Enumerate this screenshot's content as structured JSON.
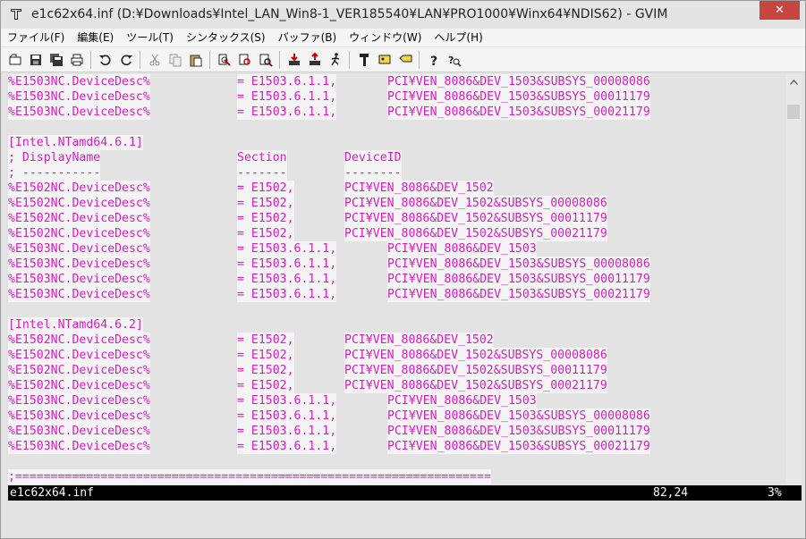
{
  "window": {
    "title": "e1c62x64.inf (D:¥Downloads¥Intel_LAN_Win8-1_VER185540¥LAN¥PRO1000¥Winx64¥NDIS62) - GVIM",
    "close_label": "✕"
  },
  "menu": [
    "ファイル(F)",
    "編集(E)",
    "ツール(T)",
    "シンタックス(S)",
    "バッファ(B)",
    "ウィンドウ(W)",
    "ヘルプ(H)"
  ],
  "toolbar": {
    "icons": [
      "open-icon",
      "save-icon",
      "save-all-icon",
      "print-icon",
      "sep",
      "undo-icon",
      "redo-icon",
      "sep",
      "cut-icon",
      "copy-icon",
      "paste-icon",
      "sep",
      "replace-icon",
      "find-next-icon",
      "find-prev-icon",
      "sep",
      "load-session-icon",
      "save-session-icon",
      "run-script-icon",
      "sep",
      "make-icon",
      "tags-icon",
      "jump-tag-icon",
      "sep",
      "help-icon",
      "find-help-icon"
    ]
  },
  "editor": {
    "lines": [
      {
        "t": "e",
        "c0": "%E1503NC.DeviceDesc%",
        "c1": "= E1503.6.1.1,",
        "c2": "PCI¥VEN_8086&DEV_1503&SUBSYS_00008086",
        "c2b": true
      },
      {
        "t": "e",
        "c0": "%E1503NC.DeviceDesc%",
        "c1": "= E1503.6.1.1,",
        "c2": "PCI¥VEN_8086&DEV_1503&SUBSYS_00011179",
        "c2b": true
      },
      {
        "t": "e",
        "c0": "%E1503NC.DeviceDesc%",
        "c1": "= E1503.6.1.1,",
        "c2": "PCI¥VEN_8086&DEV_1503&SUBSYS_00021179",
        "c2b": true
      },
      {
        "t": "blank"
      },
      {
        "t": "s",
        "c0": "[Intel.NTamd64.6.1]"
      },
      {
        "t": "h",
        "c0": "; DisplayName",
        "c1": "Section",
        "c2": "DeviceID"
      },
      {
        "t": "h",
        "c0": "; -----------",
        "c1": "-------",
        "c2": "--------"
      },
      {
        "t": "e",
        "c0": "%E1502NC.DeviceDesc%",
        "c1": "= E1502,",
        "c2": "PCI¥VEN_8086&DEV_1502"
      },
      {
        "t": "e",
        "c0": "%E1502NC.DeviceDesc%",
        "c1": "= E1502,",
        "c2": "PCI¥VEN_8086&DEV_1502&SUBSYS_00008086"
      },
      {
        "t": "e",
        "c0": "%E1502NC.DeviceDesc%",
        "c1": "= E1502,",
        "c2": "PCI¥VEN_8086&DEV_1502&SUBSYS_00011179"
      },
      {
        "t": "e",
        "c0": "%E1502NC.DeviceDesc%",
        "c1": "= E1502,",
        "c2": "PCI¥VEN_8086&DEV_1502&SUBSYS_00021179"
      },
      {
        "t": "e",
        "c0": "%E1503NC.DeviceDesc%",
        "c1": "= E1503.6.1.1,",
        "c2": "PCI¥VEN_8086&DEV_1503",
        "c2b": true
      },
      {
        "t": "e",
        "c0": "%E1503NC.DeviceDesc%",
        "c1": "= E1503.6.1.1,",
        "c2": "PCI¥VEN_8086&DEV_1503&SUBSYS_00008086",
        "c2b": true
      },
      {
        "t": "e",
        "c0": "%E1503NC.DeviceDesc%",
        "c1": "= E1503.6.1.1,",
        "c2": "PCI¥VEN_8086&DEV_1503&SUBSYS_00011179",
        "c2b": true
      },
      {
        "t": "e",
        "c0": "%E1503NC.DeviceDesc%",
        "c1": "= E1503.6.1.1,",
        "c2": "PCI¥VEN_8086&DEV_1503&SUBSYS_00021179",
        "c2b": true
      },
      {
        "t": "blank"
      },
      {
        "t": "s",
        "c0": "[Intel.NTamd64.6.2]"
      },
      {
        "t": "e",
        "c0": "%E1502NC.DeviceDesc%",
        "c1": "= E1502,",
        "c2": "PCI¥VEN_8086&DEV_1502"
      },
      {
        "t": "e",
        "c0": "%E1502NC.DeviceDesc%",
        "c1": "= E1502,",
        "c2": "PCI¥VEN_8086&DEV_1502&SUBSYS_00008086"
      },
      {
        "t": "e",
        "c0": "%E1502NC.DeviceDesc%",
        "c1": "= E1502,",
        "c2": "PCI¥VEN_8086&DEV_1502&SUBSYS_00011179"
      },
      {
        "t": "e",
        "c0": "%E1502NC.DeviceDesc%",
        "c1": "= E1502,",
        "c2": "PCI¥VEN_8086&DEV_1502&SUBSYS_00021179"
      },
      {
        "t": "e",
        "c0": "%E1503NC.DeviceDesc%",
        "c1": "= E1503.6.1.1,",
        "c2": "PCI¥VEN_8086&DEV_1503",
        "c2b": true
      },
      {
        "t": "e",
        "c0": "%E1503NC.DeviceDesc%",
        "c1": "= E1503.6.1.1,",
        "c2": "PCI¥VEN_8086&DEV_1503&SUBSYS_00008086",
        "c2b": true
      },
      {
        "t": "e",
        "c0": "%E1503NC.DeviceDesc%",
        "c1": "= E1503.6.1.1,",
        "c2": "PCI¥VEN_8086&DEV_1503&SUBSYS_00011179",
        "c2b": true
      },
      {
        "t": "e",
        "c0": "%E1503NC.DeviceDesc%",
        "c1": "= E1503.6.1.1,",
        "c2": "PCI¥VEN_8086&DEV_1503&SUBSYS_00021179",
        "c2b": true
      },
      {
        "t": "blank"
      },
      {
        "t": "d",
        "c0": ";==================================================================="
      }
    ]
  },
  "statusline": {
    "filename": "e1c62x64.inf",
    "position": "82,24",
    "percent": "3%"
  },
  "colors": {
    "identifier": "#d61fbf",
    "comment": "#3338c7",
    "status_bg": "#000000"
  }
}
